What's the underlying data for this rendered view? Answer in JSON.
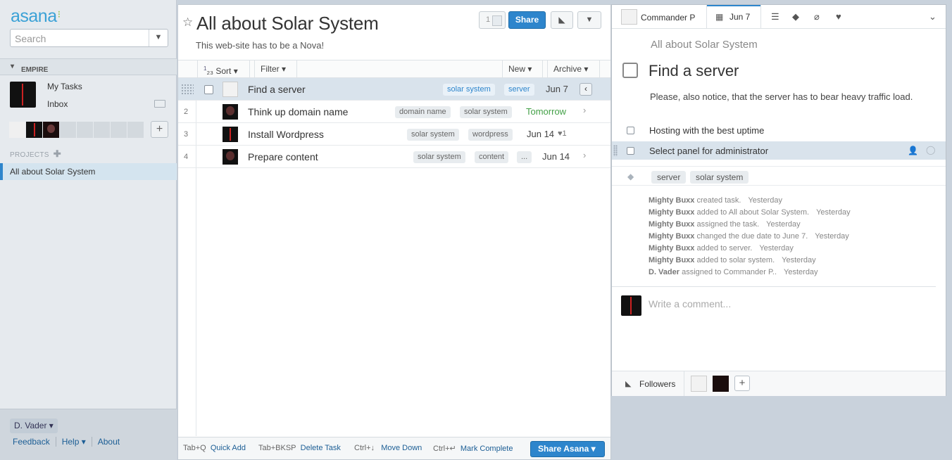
{
  "sidebar": {
    "logo": "asana",
    "search_placeholder": "Search",
    "workspace": "EMPIRE",
    "my_tasks": "My Tasks",
    "inbox": "Inbox",
    "projects_label": "PROJECTS",
    "projects": [
      "All about Solar System"
    ],
    "user": "D. Vader",
    "footer_links": [
      "Feedback",
      "Help",
      "About"
    ]
  },
  "project": {
    "title": "All about Solar System",
    "description": "This web-site has to be a Nova!",
    "member_count": "1",
    "share_label": "Share",
    "toolbar": {
      "sort": "Sort",
      "filter": "Filter",
      "new": "New",
      "archive": "Archive"
    },
    "tasks": [
      {
        "num": "",
        "name": "Find a server",
        "tags": [
          "solar system",
          "server"
        ],
        "due": "Jun 7",
        "selected": true
      },
      {
        "num": "2",
        "name": "Think up domain name",
        "tags": [
          "domain name",
          "solar system"
        ],
        "due": "Tomorrow"
      },
      {
        "num": "3",
        "name": "Install Wordpress",
        "tags": [
          "solar system",
          "wordpress"
        ],
        "due": "Jun 14",
        "hearts": "1"
      },
      {
        "num": "4",
        "name": "Prepare content",
        "tags": [
          "solar system",
          "content",
          "..."
        ],
        "due": "Jun 14"
      }
    ],
    "shortcuts": [
      {
        "key": "Tab+Q",
        "action": "Quick Add"
      },
      {
        "key": "Tab+BKSP",
        "action": "Delete Task"
      },
      {
        "key": "Ctrl+↓",
        "action": "Move Down"
      },
      {
        "key": "Ctrl+↵",
        "action": "Mark Complete"
      }
    ],
    "share_asana": "Share Asana"
  },
  "detail": {
    "assignee": "Commander P",
    "due": "Jun 7",
    "project": "All about Solar System",
    "title": "Find a server",
    "description": "Please, also notice, that the server has to bear heavy traffic load.",
    "subtasks": [
      "Hosting with the best uptime",
      "Select panel for administrator"
    ],
    "tags": [
      "server",
      "solar system"
    ],
    "stories": [
      {
        "who": "Mighty Buxx",
        "what": "created task.",
        "when": "Yesterday"
      },
      {
        "who": "Mighty Buxx",
        "what": "added to All about Solar System.",
        "when": "Yesterday"
      },
      {
        "who": "Mighty Buxx",
        "what": "assigned the task.",
        "when": "Yesterday"
      },
      {
        "who": "Mighty Buxx",
        "what": "changed the due date to June 7.",
        "when": "Yesterday"
      },
      {
        "who": "Mighty Buxx",
        "what": "added to server.",
        "when": "Yesterday"
      },
      {
        "who": "Mighty Buxx",
        "what": "added to solar system.",
        "when": "Yesterday"
      },
      {
        "who": "D. Vader",
        "what": "assigned to Commander P..",
        "when": "Yesterday"
      }
    ],
    "comment_placeholder": "Write a comment...",
    "followers_label": "Followers"
  },
  "colors": {
    "accent": "#2d85cc",
    "due_soon": "#43a047",
    "selected_row": "#d9e3ec"
  }
}
